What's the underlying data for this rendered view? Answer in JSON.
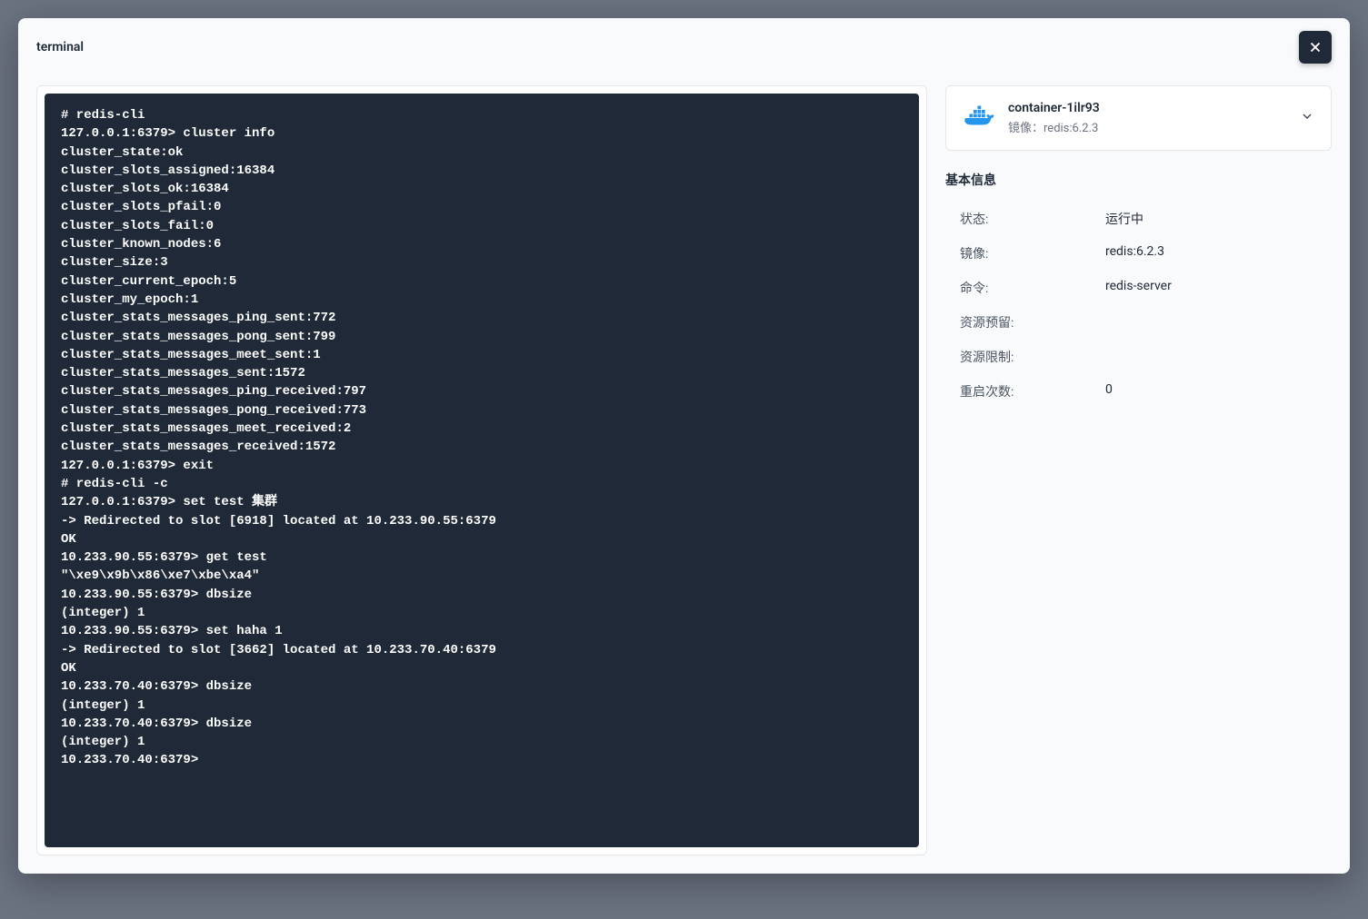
{
  "header": {
    "title": "terminal"
  },
  "terminal_output": "# redis-cli\n127.0.0.1:6379> cluster info\ncluster_state:ok\ncluster_slots_assigned:16384\ncluster_slots_ok:16384\ncluster_slots_pfail:0\ncluster_slots_fail:0\ncluster_known_nodes:6\ncluster_size:3\ncluster_current_epoch:5\ncluster_my_epoch:1\ncluster_stats_messages_ping_sent:772\ncluster_stats_messages_pong_sent:799\ncluster_stats_messages_meet_sent:1\ncluster_stats_messages_sent:1572\ncluster_stats_messages_ping_received:797\ncluster_stats_messages_pong_received:773\ncluster_stats_messages_meet_received:2\ncluster_stats_messages_received:1572\n127.0.0.1:6379> exit\n# redis-cli -c\n127.0.0.1:6379> set test 集群\n-> Redirected to slot [6918] located at 10.233.90.55:6379\nOK\n10.233.90.55:6379> get test\n\"\\xe9\\x9b\\x86\\xe7\\xbe\\xa4\"\n10.233.90.55:6379> dbsize\n(integer) 1\n10.233.90.55:6379> set haha 1\n-> Redirected to slot [3662] located at 10.233.70.40:6379\nOK\n10.233.70.40:6379> dbsize\n(integer) 1\n10.233.70.40:6379> dbsize\n(integer) 1\n10.233.70.40:6379>",
  "container": {
    "name": "container-1ilr93",
    "image_label": "镜像：",
    "image_value": "redis:6.2.3"
  },
  "basic_info": {
    "title": "基本信息",
    "rows": [
      {
        "label": "状态:",
        "value": "运行中"
      },
      {
        "label": "镜像:",
        "value": "redis:6.2.3"
      },
      {
        "label": "命令:",
        "value": "redis-server"
      },
      {
        "label": "资源预留:",
        "value": ""
      },
      {
        "label": "资源限制:",
        "value": ""
      },
      {
        "label": "重启次数:",
        "value": "0"
      }
    ]
  }
}
